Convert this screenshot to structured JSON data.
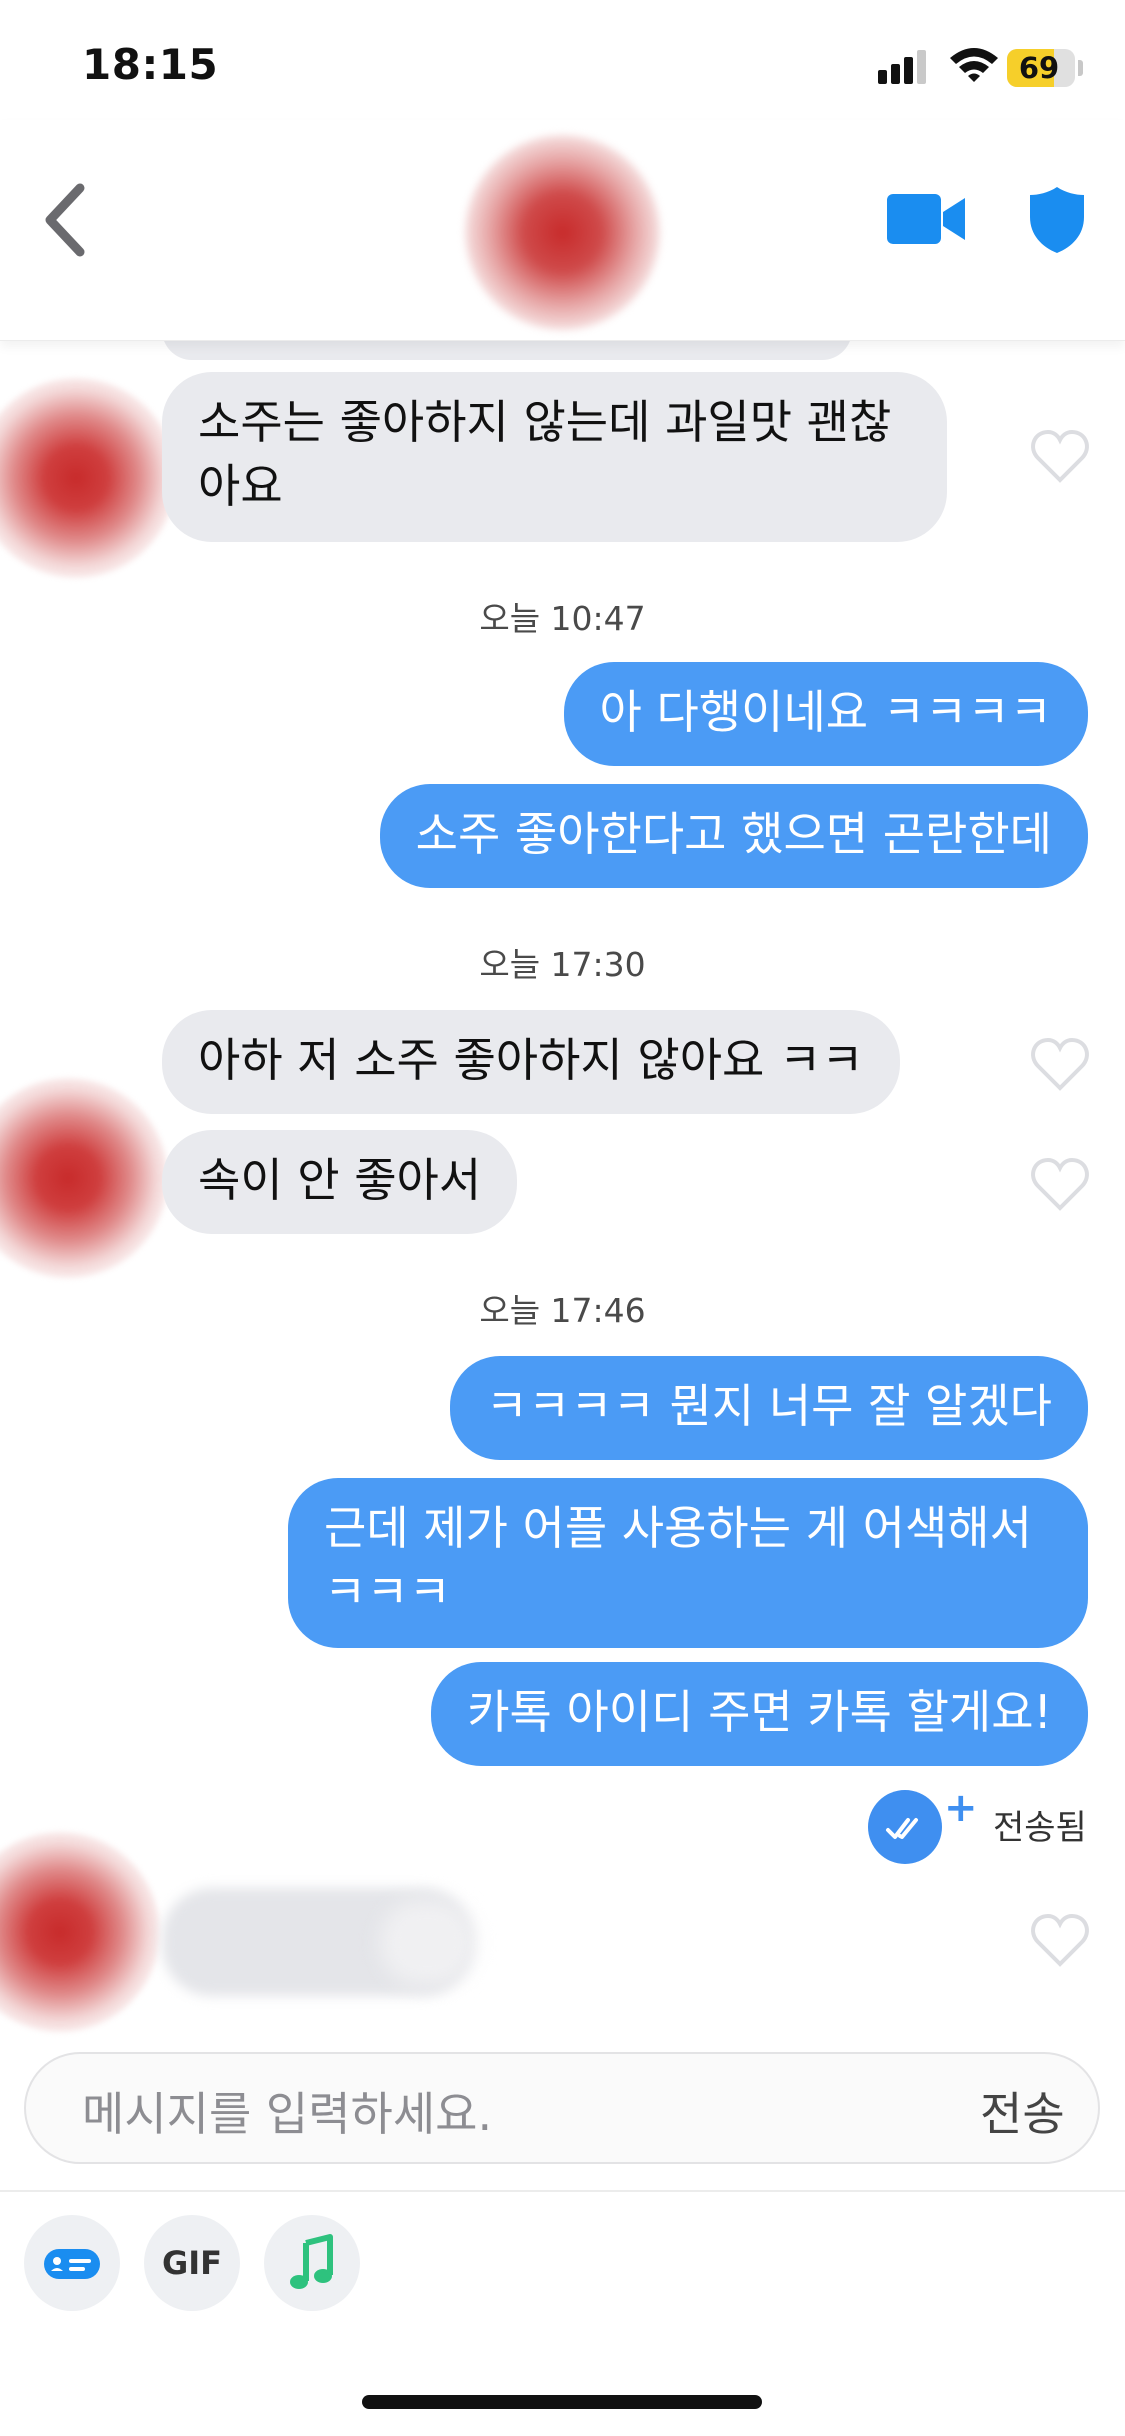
{
  "status_bar": {
    "time": "18:15",
    "battery": "69",
    "battery_level": 0.69
  },
  "header": {
    "back_icon": "chevron-left-icon",
    "video_icon": "video-camera-icon",
    "shield_icon": "shield-icon",
    "accent_color": "#1a8df0"
  },
  "messages": {
    "m1": "소주는 좋아하지 않는데 과일맛 괜찮",
    "m1b": "아요",
    "ts1": "오늘 10:47",
    "m2": "아 다행이네요 ㅋㅋㅋㅋ",
    "m3": "소주 좋아한다고 했으면 곤란한데",
    "ts2": "오늘 17:30",
    "m4": "아하 저 소주 좋아하지 않아요 ㅋㅋ",
    "m5": "속이 안 좋아서",
    "ts3": "오늘 17:46",
    "m6": "ㅋㅋㅋㅋ 뭔지 너무 잘 알겠다",
    "m7": "근데 제가 어플 사용하는 게 어색해서",
    "m7b": "ㅋㅋㅋ",
    "m8": "카톡 아이디 주면 카톡 할게요!",
    "read_status": "전송됨",
    "read_plus": "+"
  },
  "colors": {
    "sent_bubble": "#4b9bf5",
    "received_bubble": "#e9eaee"
  },
  "composer": {
    "placeholder": "메시지를 입력하세요.",
    "send_label": "전송",
    "tools": [
      {
        "icon": "sticker-card-icon"
      },
      {
        "label": "GIF"
      },
      {
        "icon": "music-note-icon"
      }
    ]
  }
}
